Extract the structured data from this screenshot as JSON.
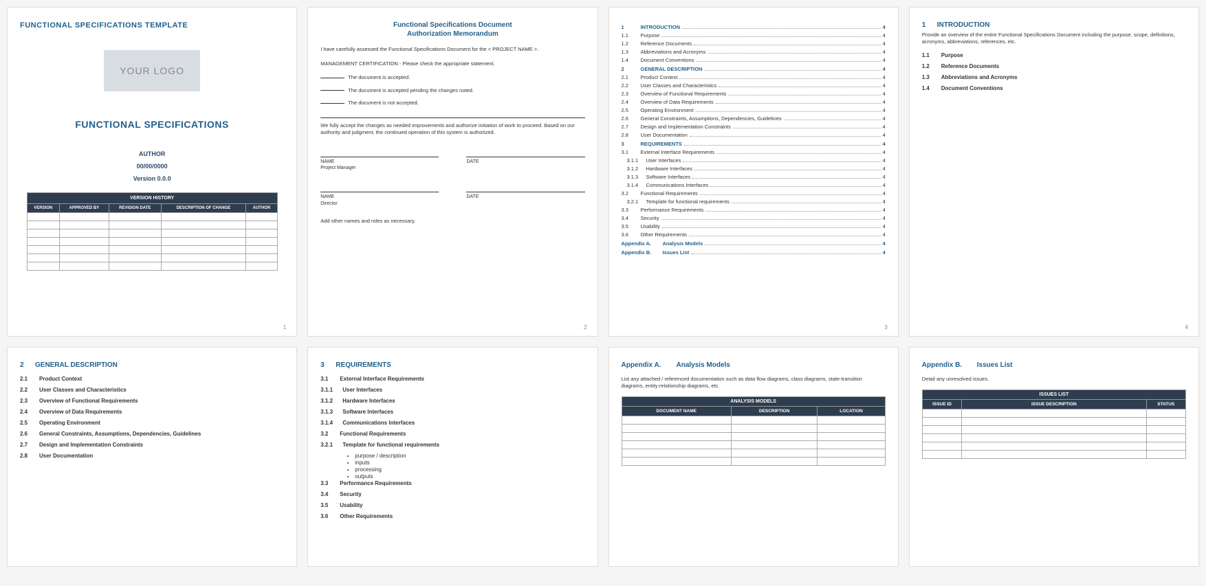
{
  "page1": {
    "header": "FUNCTIONAL SPECIFICATIONS TEMPLATE",
    "logo": "YOUR LOGO",
    "title": "FUNCTIONAL SPECIFICATIONS",
    "author": "AUTHOR",
    "date": "00/00/0000",
    "version": "Version 0.0.0",
    "table_title": "VERSION HISTORY",
    "cols": [
      "VERSION",
      "APPROVED BY",
      "REVISION DATE",
      "DESCRIPTION OF CHANGE",
      "AUTHOR"
    ],
    "page_num": "1"
  },
  "page2": {
    "title1": "Functional Specifications Document",
    "title2": "Authorization Memorandum",
    "intro": "I have carefully assessed the Functional Specifications Document for the < PROJECT NAME >.",
    "cert": "MANAGEMENT CERTIFICATION - Please check the appropriate statement.",
    "opt1": "The document is accepted.",
    "opt2": "The document is accepted pending the changes noted.",
    "opt3": "The document is not accepted.",
    "accept": "We fully accept the changes as needed improvements and authorize initiation of work to proceed. Based on our authority and judgment, the continued operation of this system is authorized.",
    "name": "NAME",
    "date": "DATE",
    "role1": "Project Manager",
    "role2": "Director",
    "addnote": "Add other names and roles as necessary.",
    "page_num": "2"
  },
  "page3": {
    "items": [
      {
        "n": "1",
        "t": "INTRODUCTION",
        "p": "4",
        "bold": true
      },
      {
        "n": "1.1",
        "t": "Purpose",
        "p": "4"
      },
      {
        "n": "1.2",
        "t": "Reference Documents",
        "p": "4"
      },
      {
        "n": "1.3",
        "t": "Abbreviations and Acronyms",
        "p": "4"
      },
      {
        "n": "1.4",
        "t": "Document Conventions",
        "p": "4"
      },
      {
        "n": "2",
        "t": "GENERAL DESCRIPTION",
        "p": "4",
        "bold": true
      },
      {
        "n": "2.1",
        "t": "Product Context",
        "p": "4"
      },
      {
        "n": "2.2",
        "t": "User Classes and Characteristics",
        "p": "4"
      },
      {
        "n": "2.3",
        "t": "Overview of Functional Requirements",
        "p": "4"
      },
      {
        "n": "2.4",
        "t": "Overview of Data Requirements",
        "p": "4"
      },
      {
        "n": "2.5",
        "t": "Operating Environment",
        "p": "4"
      },
      {
        "n": "2.6",
        "t": "General Constraints, Assumptions, Dependencies, Guidelines",
        "p": "4"
      },
      {
        "n": "2.7",
        "t": "Design and Implementation Constraints",
        "p": "4"
      },
      {
        "n": "2.8",
        "t": "User Documentation",
        "p": "4"
      },
      {
        "n": "3",
        "t": "REQUIREMENTS",
        "p": "4",
        "bold": true
      },
      {
        "n": "3.1",
        "t": "External Interface Requirements",
        "p": "4"
      },
      {
        "n": "3.1.1",
        "t": "User Interfaces",
        "p": "4",
        "sub": true
      },
      {
        "n": "3.1.2",
        "t": "Hardware Interfaces",
        "p": "4",
        "sub": true
      },
      {
        "n": "3.1.3",
        "t": "Software Interfaces",
        "p": "4",
        "sub": true
      },
      {
        "n": "3.1.4",
        "t": "Communications Interfaces",
        "p": "4",
        "sub": true
      },
      {
        "n": "3.2",
        "t": "Functional Requirements",
        "p": "4"
      },
      {
        "n": "3.2.1",
        "t": "Template for functional requirements",
        "p": "4",
        "sub": true
      },
      {
        "n": "3.3",
        "t": "Performance Requirements",
        "p": "4"
      },
      {
        "n": "3.4",
        "t": "Security",
        "p": "4"
      },
      {
        "n": "3.5",
        "t": "Usability",
        "p": "4"
      },
      {
        "n": "3.6",
        "t": "Other Requirements",
        "p": "4"
      },
      {
        "n": "Appendix A.",
        "t": "Analysis Models",
        "p": "4",
        "bold": true,
        "appendix": true
      },
      {
        "n": "Appendix B.",
        "t": "Issues List",
        "p": "4",
        "bold": true,
        "appendix": true
      }
    ],
    "page_num": "3"
  },
  "page4": {
    "head_n": "1",
    "head_t": "INTRODUCTION",
    "desc": "Provide an overview of the entire Functional Specifications Document including the purpose, scope, definitions, acronyms, abbreviations, references, etc.",
    "items": [
      {
        "n": "1.1",
        "t": "Purpose"
      },
      {
        "n": "1.2",
        "t": "Reference Documents"
      },
      {
        "n": "1.3",
        "t": "Abbreviations and Acronyms"
      },
      {
        "n": "1.4",
        "t": "Document Conventions"
      }
    ],
    "page_num": "4"
  },
  "page5": {
    "head_n": "2",
    "head_t": "GENERAL DESCRIPTION",
    "items": [
      {
        "n": "2.1",
        "t": "Product Context"
      },
      {
        "n": "2.2",
        "t": "User Classes and Characteristics"
      },
      {
        "n": "2.3",
        "t": "Overview of Functional Requirements"
      },
      {
        "n": "2.4",
        "t": "Overview of Data Requirements"
      },
      {
        "n": "2.5",
        "t": "Operating Environment"
      },
      {
        "n": "2.6",
        "t": "General Constraints, Assumptions, Dependencies, Guidelines"
      },
      {
        "n": "2.7",
        "t": "Design and Implementation Constraints"
      },
      {
        "n": "2.8",
        "t": "User Documentation"
      }
    ]
  },
  "page6": {
    "head_n": "3",
    "head_t": "REQUIREMENTS",
    "items": [
      {
        "n": "3.1",
        "t": "External Interface Requirements"
      },
      {
        "n": "3.1.1",
        "t": "User Interfaces",
        "sub": true
      },
      {
        "n": "3.1.2",
        "t": "Hardware Interfaces",
        "sub": true
      },
      {
        "n": "3.1.3",
        "t": "Software Interfaces",
        "sub": true
      },
      {
        "n": "3.1.4",
        "t": "Communications Interfaces",
        "sub": true
      },
      {
        "n": "3.2",
        "t": "Functional Requirements"
      },
      {
        "n": "3.2.1",
        "t": "Template for functional requirements",
        "sub": true,
        "bullets": [
          "purpose / description",
          "inputs",
          "processing",
          "outputs"
        ]
      },
      {
        "n": "3.3",
        "t": "Performance Requirements"
      },
      {
        "n": "3.4",
        "t": "Security"
      },
      {
        "n": "3.5",
        "t": "Usability"
      },
      {
        "n": "3.6",
        "t": "Other Requirements"
      }
    ]
  },
  "page7": {
    "lbl": "Appendix A.",
    "title": "Analysis Models",
    "desc": "List any attached / referenced documentation such as data flow diagrams, class diagrams, state-transition diagrams, entity-relationship diagrams, etc.",
    "table_title": "ANALYSIS MODELS",
    "cols": [
      "DOCUMENT NAME",
      "DESCRIPTION",
      "LOCATION"
    ]
  },
  "page8": {
    "lbl": "Appendix B.",
    "title": "Issues List",
    "desc": "Detail any unresolved issues.",
    "table_title": "ISSUES LIST",
    "cols": [
      "ISSUE ID",
      "ISSUE DESCRIPTION",
      "STATUS"
    ]
  }
}
